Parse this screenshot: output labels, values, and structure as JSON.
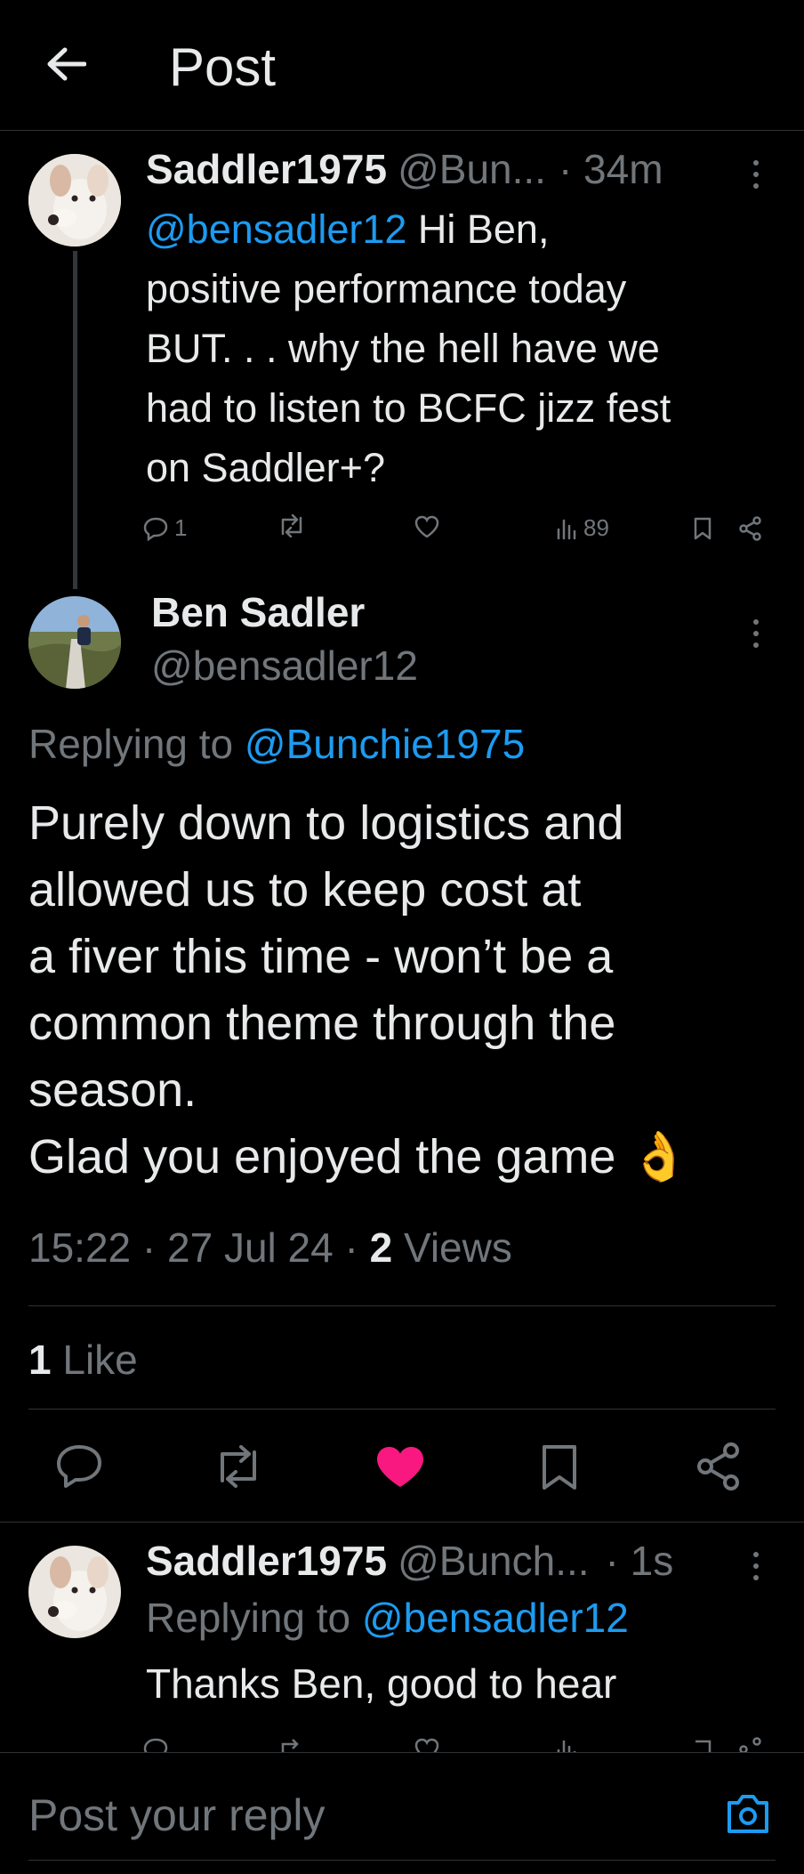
{
  "header": {
    "title": "Post"
  },
  "parent": {
    "display_name": "Saddler1975",
    "handle": "@Bun...",
    "time": "· 34m",
    "mention": "@bensadler12",
    "text_lines": [
      " Hi Ben,",
      "positive performance today",
      "BUT. . . why the hell have we",
      "had to listen to BCFC jizz fest",
      "on Saddler+?"
    ],
    "reply_count": "1",
    "views": "89"
  },
  "main": {
    "display_name": "Ben Sadler",
    "handle": "@bensadler12",
    "replying_prefix": "Replying to ",
    "replying_to": "@Bunchie1975",
    "text_lines": [
      "Purely down to logistics and",
      "allowed us to keep cost at",
      "a fiver this time - won’t be a",
      "common theme through the",
      "season.",
      "Glad you enjoyed the game 👌"
    ],
    "time": "15:22",
    "date": "27 Jul 24",
    "views_count": "2",
    "views_label": "Views",
    "likes_count": "1",
    "likes_label": "Like",
    "like_color": "#f91880"
  },
  "reply": {
    "display_name": "Saddler1975",
    "handle": "@Bunch...",
    "time": "· 1s",
    "replying_prefix": "Replying to ",
    "replying_to": "@bensadler12",
    "text": "Thanks Ben, good to hear"
  },
  "composer": {
    "placeholder": "Post your reply"
  },
  "colors": {
    "accent": "#1d9bf0",
    "muted": "#71767b",
    "like": "#f91880"
  }
}
